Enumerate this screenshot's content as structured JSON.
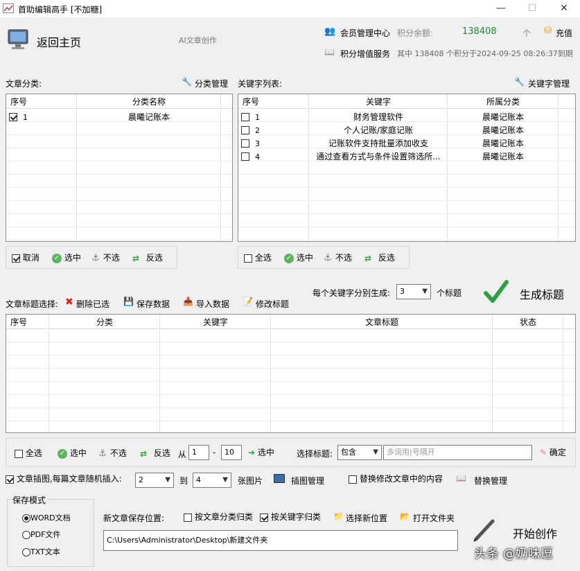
{
  "titlebar": {
    "title": "首助编辑高手 [不加糖]",
    "minimize": "—",
    "maximize": "☐",
    "close": "✕"
  },
  "header": {
    "home_label": "返回主页",
    "ai_label": "AI文章创作",
    "member_center": "会员管理中心",
    "points_balance_label": "积分余额:",
    "points_value": "138408",
    "unit": "个",
    "recharge": "充值",
    "points_service": "积分增值服务",
    "expiry_text": "其中 138408 个积分于2024-09-25 08:26:37到期"
  },
  "category": {
    "section_label": "文章分类:",
    "manage_label": "分类管理",
    "columns": [
      "序号",
      "分类名称"
    ],
    "rows": [
      {
        "checked": true,
        "no": "1",
        "name": "晨曦记账本"
      }
    ],
    "buttons": {
      "cancel": "取消",
      "select": "选中",
      "unselect": "不选",
      "invert": "反选"
    }
  },
  "keywords": {
    "section_label": "关键字列表:",
    "manage_label": "关键字管理",
    "columns": [
      "序号",
      "关键字",
      "所属分类"
    ],
    "rows": [
      {
        "checked": false,
        "no": "1",
        "keyword": "财务管理软件",
        "category": "晨曦记账本"
      },
      {
        "checked": false,
        "no": "2",
        "keyword": "个人记账/家庭记账",
        "category": "晨曦记账本"
      },
      {
        "checked": false,
        "no": "3",
        "keyword": "记账软件支持批量添加收支",
        "category": "晨曦记账本"
      },
      {
        "checked": false,
        "no": "4",
        "keyword": "通过查看方式与条件设置筛选所...",
        "category": "晨曦记账本"
      }
    ],
    "buttons": {
      "all": "全选",
      "select": "选中",
      "unselect": "不选",
      "invert": "反选"
    }
  },
  "generate": {
    "per_keyword_label": "每个关键字分别生成:",
    "count_value": "3",
    "titles_unit": "个标题",
    "generate_label": "生成标题"
  },
  "titles": {
    "section_label": "文章标题选择:",
    "delete_selected": "删除已选",
    "save_data": "保存数据",
    "import_data": "导入数据",
    "edit_title": "修改标题",
    "columns": [
      "序号",
      "分类",
      "关键字",
      "文章标题",
      "状态"
    ]
  },
  "bottom_bar": {
    "all": "全选",
    "select": "选中",
    "unselect": "不选",
    "invert": "反选",
    "from": "从",
    "from_value": "1",
    "dash": "-",
    "to_value": "10",
    "select2": "选中",
    "select_title_label": "选择标题:",
    "filter_value": "包含",
    "filter_placeholder": "多词用|号隔开",
    "confirm": "确定"
  },
  "image_options": {
    "insert_label": "文章插图,每篇文章随机插入:",
    "min_value": "2",
    "to_label": "到",
    "max_value": "4",
    "unit": "张图片",
    "manage": "插图管理",
    "replace_label": "替换修改文章中的内容",
    "replace_manage": "替换管理"
  },
  "save_mode": {
    "legend": "保存模式",
    "options": [
      "WORD文档",
      "PDF文件",
      "TXT文本"
    ],
    "selected_index": 0
  },
  "save_location": {
    "label": "新文章保存位置:",
    "by_category": "按文章分类归类",
    "by_keyword": "按关键字归类",
    "choose_new": "选择新位置",
    "open_folder": "打开文件夹",
    "path": "C:\\Users\\Administrator\\Desktop\\新建文件夹"
  },
  "start": {
    "label": "开始创作"
  },
  "watermark": "头条 @奶味逗"
}
